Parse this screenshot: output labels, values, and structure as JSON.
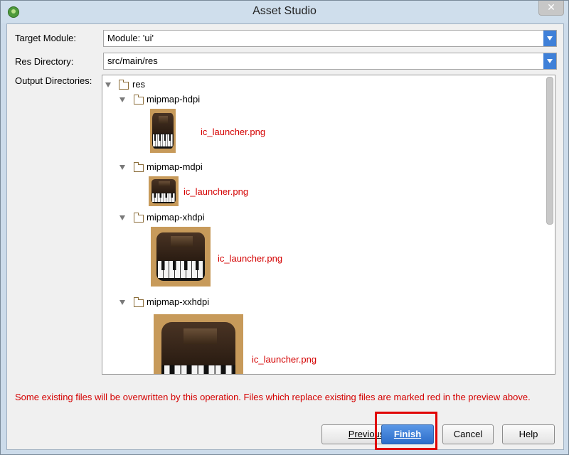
{
  "window": {
    "title": "Asset Studio",
    "close_glyph": "✕"
  },
  "form": {
    "target_module_label": "Target Module:",
    "target_module_value": "Module: 'ui'",
    "res_directory_label": "Res Directory:",
    "res_directory_value": "src/main/res",
    "output_dirs_label": "Output Directories:"
  },
  "tree": {
    "root": "res",
    "folders": [
      {
        "name": "mipmap-hdpi",
        "file": "ic_launcher.png"
      },
      {
        "name": "mipmap-mdpi",
        "file": "ic_launcher.png"
      },
      {
        "name": "mipmap-xhdpi",
        "file": "ic_launcher.png"
      },
      {
        "name": "mipmap-xxhdpi",
        "file": "ic_launcher.png"
      }
    ]
  },
  "warning": "Some existing files will be overwritten by this operation. Files which replace existing files are marked red in the preview above.",
  "buttons": {
    "previous": "Previous",
    "finish": "Finish",
    "cancel": "Cancel",
    "help": "Help"
  },
  "colors": {
    "accent": "#2c6dca",
    "warning": "#d40000",
    "highlight": "#e00000"
  },
  "icons": {
    "app": "android-studio-icon",
    "folder": "folder-icon",
    "expand": "triangle-down-icon",
    "file_preview": "piano-launcher-icon"
  }
}
